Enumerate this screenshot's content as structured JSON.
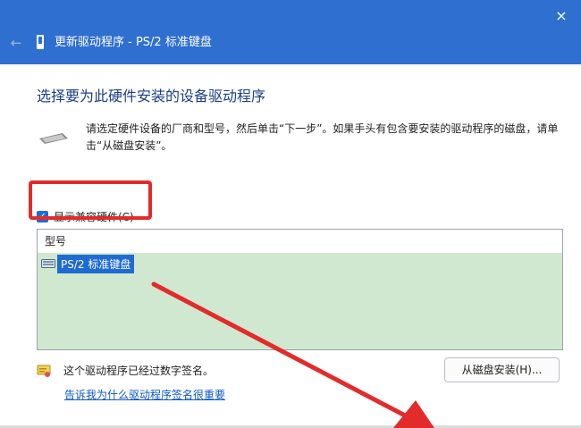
{
  "window": {
    "title": "更新驱动程序 - PS/2 标准键盘",
    "close_icon": "×",
    "back_icon": "←"
  },
  "main": {
    "heading": "选择要为此硬件安装的设备驱动程序",
    "description": "请选定硬件设备的厂商和型号，然后单击“下一步”。如果手头有包含要安装的驱动程序的磁盘，请单击“从磁盘安装”。",
    "show_compatible": {
      "label": "显示兼容硬件(C)",
      "checked": true
    },
    "model_list": {
      "header": "型号",
      "items": [
        {
          "label": "PS/2 标准键盘",
          "selected": true
        }
      ]
    },
    "signed_text": "这个驱动程序已经过数字签名。",
    "why_link": "告诉我为什么驱动程序签名很重要",
    "have_disk_button": "从磁盘安装(H)..."
  },
  "colors": {
    "header_bg": "#2f6fd0",
    "heading": "#1a3f8a",
    "selection": "#1f6bd1",
    "list_overlay": "#cfe8cf",
    "annotation_red": "#e22b2b",
    "link": "#0b57d0"
  },
  "icons": {
    "back": "back-arrow-icon",
    "title": "device-icon",
    "hardware": "keyboard-icon",
    "list_item": "keyboard-icon",
    "signed": "certificate-icon",
    "close": "close-icon"
  }
}
